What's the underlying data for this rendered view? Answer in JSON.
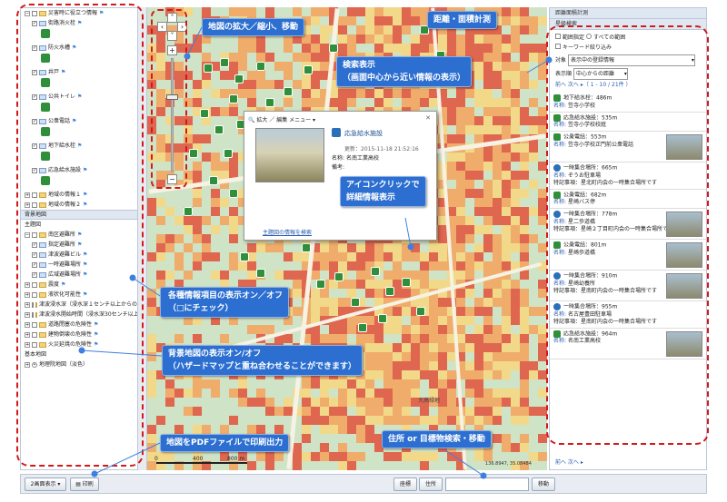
{
  "left_panel": {
    "tree": [
      {
        "label": "災害時に役立つ情報",
        "type": "folder-open",
        "indent": 0
      },
      {
        "label": "街路消火栓",
        "type": "check",
        "indent": 1
      },
      {
        "label": "防火水槽",
        "type": "check",
        "indent": 1
      },
      {
        "label": "井戸",
        "type": "check",
        "indent": 1
      },
      {
        "label": "公共トイレ",
        "type": "check",
        "indent": 1
      },
      {
        "label": "公衆電話",
        "type": "check",
        "indent": 1
      },
      {
        "label": "地下給水栓",
        "type": "check",
        "indent": 1
      },
      {
        "label": "応急給水施設",
        "type": "check",
        "indent": 1
      },
      {
        "label": "地域の情報１",
        "type": "folder",
        "indent": 0
      },
      {
        "label": "地域の情報２",
        "type": "folder",
        "indent": 0
      }
    ],
    "bg_header": "背景地図",
    "main_map_label": "主題図",
    "bg_tree": [
      {
        "label": "南区避難所",
        "type": "folder-open",
        "indent": 0
      },
      {
        "label": "指定避難所",
        "type": "check",
        "indent": 1
      },
      {
        "label": "津波避難ビル",
        "type": "check",
        "indent": 1
      },
      {
        "label": "一時避難場所",
        "type": "check",
        "indent": 1
      },
      {
        "label": "広域避難場所",
        "type": "check",
        "indent": 1
      },
      {
        "label": "震度",
        "type": "folder",
        "indent": 0
      },
      {
        "label": "液状化可能性",
        "type": "folder",
        "indent": 0
      },
      {
        "label": "津波浸水深（浸水深１センチ以上からの表示）",
        "type": "folder",
        "indent": 0
      },
      {
        "label": "津波浸水開始時間（浸水深30センチ以上からの表示）",
        "type": "folder",
        "indent": 0
      },
      {
        "label": "道路閉塞の危険性",
        "type": "folder",
        "indent": 0
      },
      {
        "label": "建物倒壊の危険性",
        "type": "folder",
        "indent": 0
      },
      {
        "label": "火災延焼の危険性",
        "type": "folder",
        "indent": 0
      }
    ],
    "base_map_label": "基本地図",
    "base_map_item": "地理院地図（淡色）"
  },
  "popup": {
    "toolbar": "拡大 ／ 編集 メニュー ▾",
    "title": "応急給水施設",
    "updated": "更新：2015-11-18 21:52:16",
    "name_label": "名称:",
    "name_value": "名南工業高校",
    "note_label": "備考:",
    "link": "主題図の情報を検索"
  },
  "right_panel": {
    "header": "距離面積計測",
    "search_header": "星級検索",
    "opt_range": "範囲指定",
    "opt_all": "すべての範囲",
    "opt_keyword": "キーワード絞り込み",
    "target_label": "対象",
    "target_value": "表示中の登録情報",
    "order_label": "表示順",
    "order_value": "中心からの距離",
    "pager": "前へ 次へ ▸（ 1 - 10 / 21件 ）",
    "results": [
      {
        "type": "地下給水栓",
        "dist": "486m",
        "name": "笠寺小学校",
        "thumb": false
      },
      {
        "type": "応急給水施設",
        "dist": "535m",
        "name": "笠寺小学校校庭",
        "thumb": false
      },
      {
        "type": "公衆電話",
        "dist": "553m",
        "name": "笠寺小学校正門前公衆電話",
        "thumb": true
      },
      {
        "type": "一時集合場所",
        "dist": "665m",
        "name": "ぞうお駐車場",
        "extra": "特記事項：星北町内会の一時集合場所です",
        "thumb": false
      },
      {
        "type": "公衆電話",
        "dist": "682m",
        "name": "星崎バス停",
        "thumb": false
      },
      {
        "type": "一時集合場所",
        "dist": "778m",
        "name": "星二歩道橋",
        "extra": "特記事項：星崎２丁目町内会の一時集合場所です",
        "thumb": true
      },
      {
        "type": "公衆電話",
        "dist": "801m",
        "name": "星崎歩道橋",
        "thumb": true
      },
      {
        "type": "一時集合場所",
        "dist": "910m",
        "name": "星崎幼養所",
        "extra": "特記事項：星南町内会の一時集合場所です",
        "thumb": true
      },
      {
        "type": "一時集合場所",
        "dist": "955m",
        "name": "名古屋豊田駐車場",
        "extra": "特記事項：星南町内会の一時集合場所です",
        "thumb": false
      },
      {
        "type": "応急給水施設",
        "dist": "964m",
        "name": "名南工業高校",
        "thumb": true
      }
    ],
    "pager_bottom": "前へ 次へ ▸"
  },
  "callouts": {
    "zoom": "地図の拡大／縮小、移動",
    "measure": "距離・面積計測",
    "search": "検索表示\n（画面中心から近い情報の表示）",
    "icon_click": "アイコンクリックで\n詳細情報表示",
    "layer_toggle": "各種情報項目の表示オン／オフ\n（□にチェック）",
    "bg_toggle": "背景地図の表示オン/オフ\n（ハザードマップと重ね合わせることができます）",
    "pdf": "地図をPDFファイルで印刷出力",
    "address": "住所 or 目標物検索・移動"
  },
  "map": {
    "scale_0": "0",
    "scale_400": "400",
    "scale_800": "800 m",
    "coords": "136.8947, 35.08484",
    "place1": "大高緑地",
    "place2": "大高"
  },
  "bottom": {
    "split_button": "2画面表示 ▾",
    "print_button": "印刷",
    "coord_button": "座標",
    "address_button": "住所",
    "move_button": "移動"
  },
  "colors": {
    "hazard_red": "#e2503a",
    "hazard_orange": "#f4a25a",
    "hazard_yellow": "#f8d77f",
    "callout_blue": "#2c6fd1",
    "dash_red": "#d21a1a"
  }
}
